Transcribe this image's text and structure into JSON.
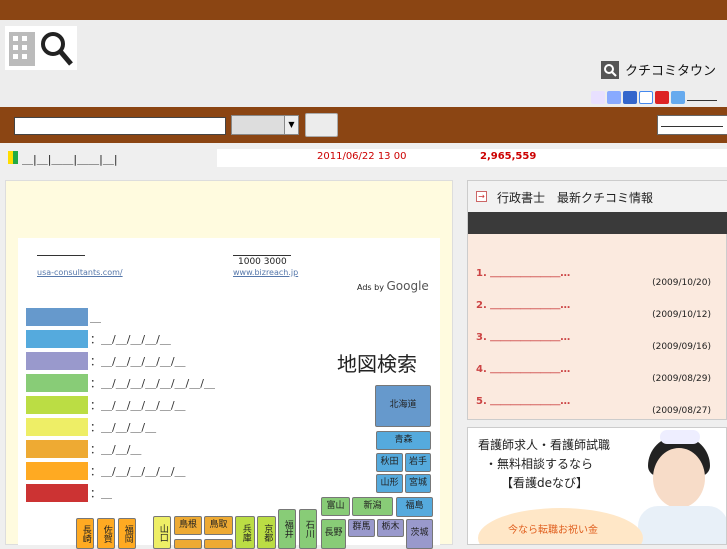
{
  "header": {
    "site_name": "クチコミタウン"
  },
  "colors": {
    "brand": "#8b4513",
    "accent_red": "#cc0000"
  },
  "search": {
    "placeholder": "",
    "select_value": "",
    "button_label": ""
  },
  "nav": {
    "links": "＿|＿|＿＿|＿＿|＿|"
  },
  "status": {
    "datetime": "2011/06/22 13 00",
    "count": "2,965,559"
  },
  "ads": {
    "urls": [
      "usa-consultants.com/",
      "www.bizreach.jp"
    ],
    "title2": "1000  3000",
    "ads_by": "Ads by",
    "google": "Google"
  },
  "legend": [
    {
      "color": "#6699cc",
      "text": "＿"
    },
    {
      "color": "#55aadd",
      "text": "：＿/＿/＿/＿/＿"
    },
    {
      "color": "#9999cc",
      "text": "：＿/＿/＿/＿/＿/＿"
    },
    {
      "color": "#88cc77",
      "text": "：＿/＿/＿/＿/＿/＿/＿/＿"
    },
    {
      "color": "#bbdd44",
      "text": "：＿/＿/＿/＿/＿/＿"
    },
    {
      "color": "#eeee66",
      "text": "：＿/＿/＿/＿"
    },
    {
      "color": "#eeaa33",
      "text": "：＿/＿/＿"
    },
    {
      "color": "#ffaa22",
      "text": "：＿/＿/＿/＿/＿/＿"
    },
    {
      "color": "#cc3333",
      "text": "：＿"
    }
  ],
  "map": {
    "title": "地図検索",
    "prefectures": [
      "北海道",
      "青森",
      "秋田",
      "岩手",
      "山形",
      "宮城",
      "福島",
      "富山",
      "新潟",
      "群馬",
      "栃木",
      "茨城",
      "長野",
      "福井",
      "石川",
      "兵庫",
      "京都",
      "鳥根",
      "鳥取",
      "山口",
      "長崎",
      "佐賀",
      "福岡"
    ]
  },
  "sidebar": {
    "title": "行政書士　最新クチコミ情報",
    "news": [
      {
        "num": "1.",
        "title": "＿＿＿＿＿＿＿…",
        "date": "(2009/10/20)"
      },
      {
        "num": "2.",
        "title": "＿＿＿＿＿＿＿…",
        "date": "(2009/10/12)"
      },
      {
        "num": "3.",
        "title": "＿＿＿＿＿＿＿…",
        "date": "(2009/09/16)"
      },
      {
        "num": "4.",
        "title": "＿＿＿＿＿＿＿…",
        "date": "(2009/08/29)"
      },
      {
        "num": "5.",
        "title": "＿＿＿＿＿＿＿…",
        "date": "(2009/08/27)"
      }
    ]
  },
  "banner": {
    "line1": "看護師求人・看護師試職",
    "line2": "・無料相談するなら",
    "line3": "【看護deなび】",
    "line4": "今なら転職お祝い金"
  }
}
